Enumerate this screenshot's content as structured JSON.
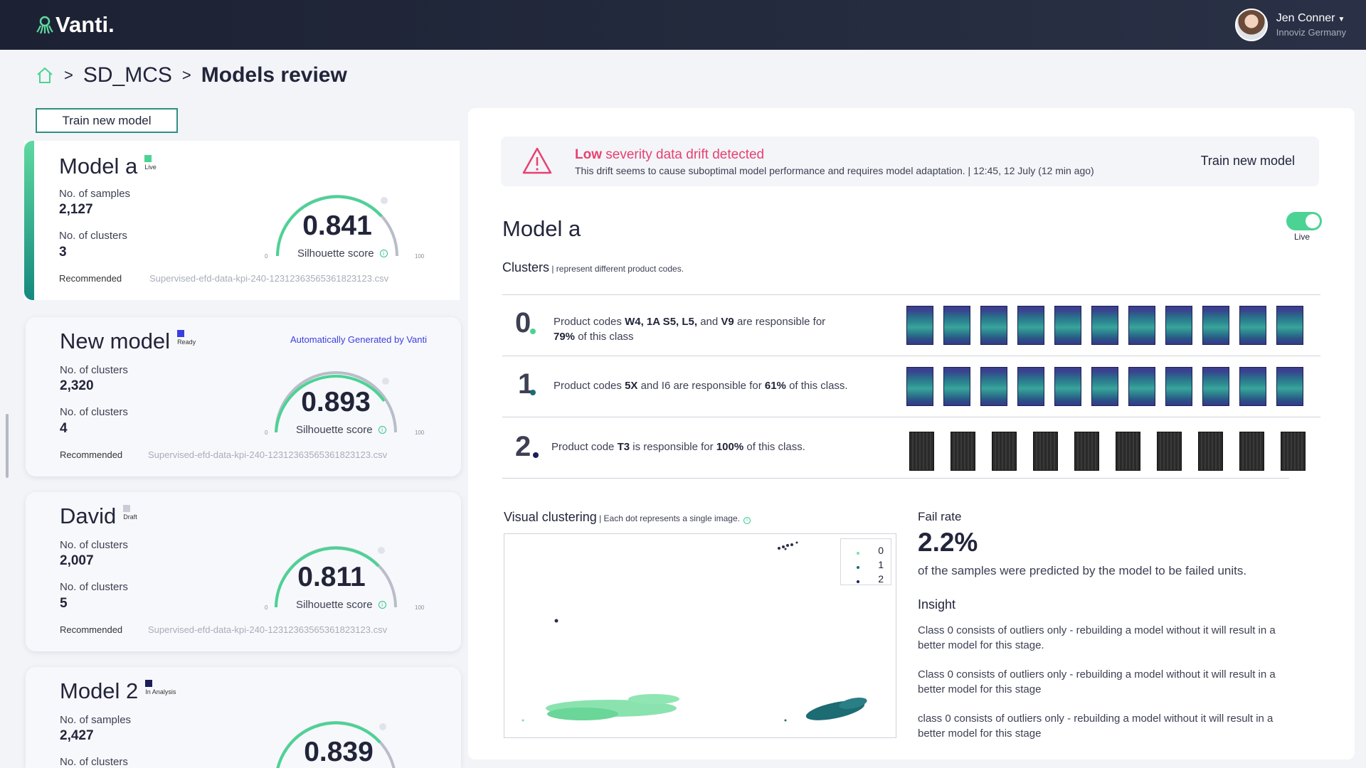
{
  "header": {
    "logo_text": "Vanti.",
    "user_name": "Jen Conner",
    "user_org": "Innoviz Germany"
  },
  "breadcrumb": {
    "items": [
      "SD_MCS",
      "Models review"
    ]
  },
  "left": {
    "train_label": "Train new model",
    "cards": [
      {
        "title": "Model a",
        "status": "Live",
        "status_color": "#4bd394",
        "m1_label": "No. of samples",
        "m1_value": "2,127",
        "m2_label": "No. of clusters",
        "m2_value": "3",
        "score": "0.841",
        "score_label": "Silhouette score",
        "tick_min": "0",
        "tick_max": "100",
        "rec": "Recommended",
        "file": "Supervised-efd-data-kpi-240-12312363565361823123.csv"
      },
      {
        "title": "New model",
        "status": "Ready",
        "status_color": "#3b3fe0",
        "auto_note": "Automatically Generated by Vanti",
        "m1_label": "No. of clusters",
        "m1_value": "2,320",
        "m2_label": "No. of clusters",
        "m2_value": "4",
        "score": "0.893",
        "score_label": "Silhouette score",
        "tick_min": "0",
        "tick_max": "100",
        "rec": "Recommended",
        "file": "Supervised-efd-data-kpi-240-12312363565361823123.csv"
      },
      {
        "title": "David",
        "status": "Draft",
        "status_color": "#c9ccd6",
        "m1_label": "No. of clusters",
        "m1_value": "2,007",
        "m2_label": "No. of clusters",
        "m2_value": "5",
        "score": "0.811",
        "score_label": "Silhouette score",
        "tick_min": "0",
        "tick_max": "100",
        "rec": "Recommended",
        "file": "Supervised-efd-data-kpi-240-12312363565361823123.csv"
      },
      {
        "title": "Model 2",
        "status": "In Analysis",
        "status_color": "#1a1f5a",
        "m1_label": "No. of samples",
        "m1_value": "2,427",
        "m2_label": "No. of clusters",
        "score": "0.839"
      }
    ]
  },
  "alert": {
    "severity": "Low",
    "title_rest": " severity data drift detected",
    "body": "This drift seems to cause suboptimal model performance and requires model adaptation.  | 12:45, 12 July (12 min ago)",
    "button": "Train new model"
  },
  "detail": {
    "title": "Model a",
    "toggle_label": "Live",
    "clusters_title": "Clusters",
    "clusters_sub": " | represent different product codes.",
    "clusters": [
      {
        "num": "0",
        "dot_color": "#4bd394",
        "pre": "Product codes ",
        "codes": "W4, 1A S5, L5,",
        "mid": " and ",
        "codes2": "V9",
        "post": " are responsible for",
        "pct": "79%",
        "tail": " of this class"
      },
      {
        "num": "1",
        "dot_color": "#1d6b73",
        "pre": "Product codes ",
        "codes": "5X",
        "mid": " and I6 are responsible for ",
        "pct": "61%",
        "tail": " of this class."
      },
      {
        "num": "2",
        "dot_color": "#1a1f5a",
        "pre": "Product code ",
        "codes": "T3",
        "mid": " is responsible for ",
        "pct": "100%",
        "tail": " of this class."
      }
    ],
    "visual_title": "Visual clustering",
    "visual_sub": " | Each dot represents a single image.",
    "legend": [
      "0",
      "1",
      "2"
    ],
    "fail_label": "Fail rate",
    "fail_value": "2.2%",
    "fail_desc": "of the samples were predicted by the model to be failed units.",
    "insight_label": "Insight",
    "insights": [
      "Class 0 consists of outliers only - rebuilding a model without it will result in a better model for this stage.",
      "Class 0 consists of outliers only - rebuilding a model without it will result in a better model for this stage",
      "class 0 consists of outliers only - rebuilding a model without it will result in a better model for this stage"
    ]
  },
  "colors": {
    "accent_green": "#4bd394",
    "teal": "#1d6b73",
    "alert_red": "#e8416f",
    "link_blue": "#3b3fe0"
  }
}
